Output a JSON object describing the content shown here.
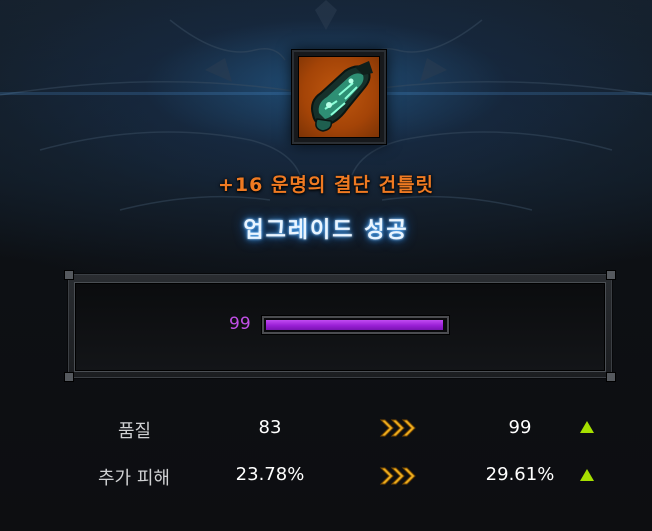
{
  "item": {
    "name": "+16 운명의 결단 건틀릿",
    "icon": "gauntlet-icon"
  },
  "result_title": "업그레이드 성공",
  "quality_bar": {
    "value": 99,
    "label": "99",
    "fill_fraction": 0.99,
    "color": "#a52fe0"
  },
  "stats": [
    {
      "label": "품질",
      "before": "83",
      "after": "99"
    },
    {
      "label": "추가 피해",
      "before": "23.78%",
      "after": "29.61%"
    }
  ],
  "colors": {
    "item_name": "#ef7a22",
    "title_glow": "#3ea8ff",
    "arrow": "#f0b021",
    "increase_icon": "#a6e000"
  }
}
